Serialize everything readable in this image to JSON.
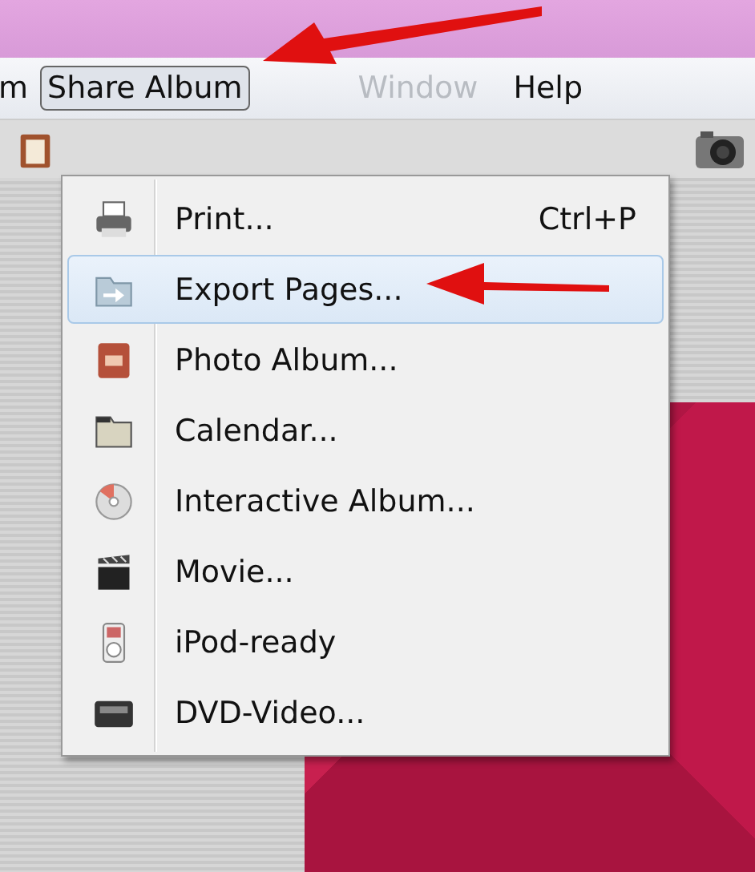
{
  "menubar": {
    "items": [
      {
        "label": "m",
        "selected": false,
        "disabled": false
      },
      {
        "label": "Share Album",
        "selected": true,
        "disabled": false
      },
      {
        "label": "Window",
        "selected": false,
        "disabled": true
      },
      {
        "label": "Help",
        "selected": false,
        "disabled": false
      }
    ]
  },
  "dropdown": {
    "items": [
      {
        "kind": "printer",
        "label": "Print...",
        "shortcut": "Ctrl+P",
        "selected": false
      },
      {
        "kind": "export",
        "label": "Export Pages...",
        "selected": true
      },
      {
        "kind": "photo",
        "label": "Photo Album...",
        "selected": false
      },
      {
        "kind": "calendar",
        "label": "Calendar...",
        "selected": false
      },
      {
        "kind": "disc",
        "label": "Interactive Album...",
        "selected": false
      },
      {
        "kind": "movie",
        "label": "Movie...",
        "selected": false
      },
      {
        "kind": "ipod",
        "label": "iPod-ready",
        "selected": false
      },
      {
        "kind": "dvd",
        "label": "DVD-Video...",
        "selected": false
      }
    ]
  }
}
